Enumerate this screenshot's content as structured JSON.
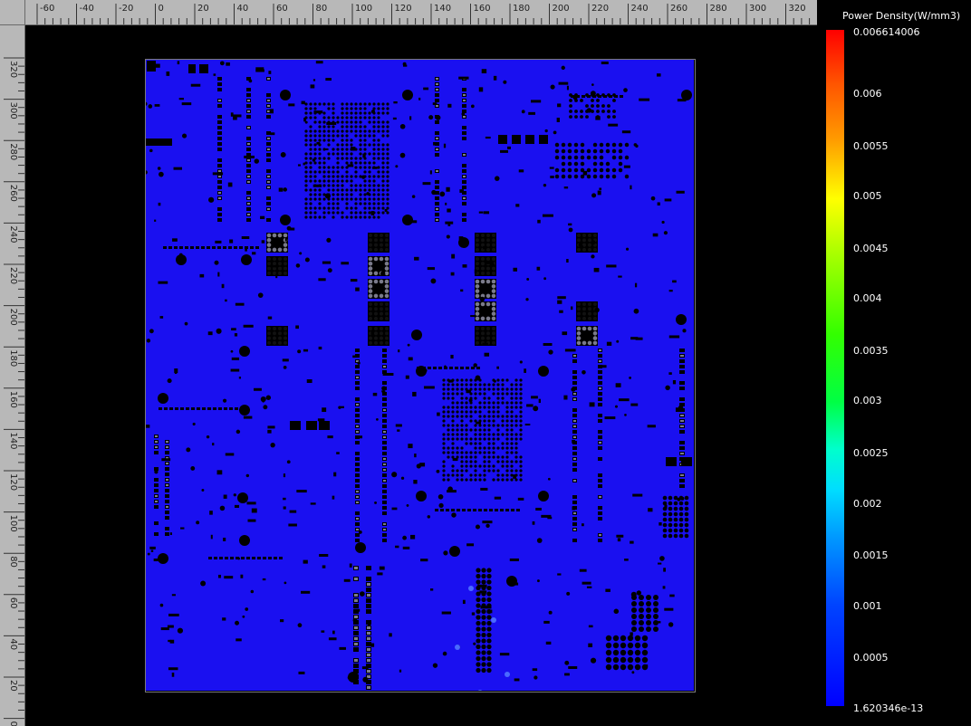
{
  "ruler": {
    "top_labels": [
      "-60",
      "-40",
      "-20",
      "0",
      "20",
      "40",
      "60",
      "80",
      "100",
      "120",
      "140",
      "160",
      "180",
      "200",
      "220",
      "240",
      "260",
      "280",
      "300",
      "320"
    ],
    "left_labels": [
      "320",
      "300",
      "280",
      "260",
      "240",
      "220",
      "200",
      "180",
      "160",
      "140",
      "120",
      "100",
      "80",
      "60",
      "40",
      "20",
      "0"
    ]
  },
  "legend": {
    "title": "Power Density(W/mm3)",
    "labels": [
      "0.006614006",
      "0.006",
      "0.0055",
      "0.005",
      "0.0045",
      "0.004",
      "0.0035",
      "0.003",
      "0.0025",
      "0.002",
      "0.0015",
      "0.001",
      "0.0005",
      "1.620346e-13"
    ]
  },
  "colors": {
    "board_fill": "#1a10f0",
    "board_dark": "#0a0a30",
    "component": "#000000",
    "pad_gray": "#7a7a8a",
    "ruler_bg": "#b8b8b8",
    "legend_max": "#ff0000",
    "legend_min": "#0000ff"
  }
}
